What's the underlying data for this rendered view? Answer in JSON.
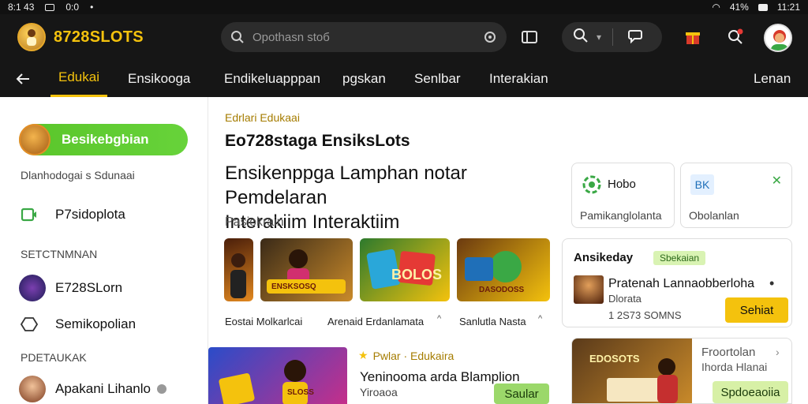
{
  "status": {
    "left_text": "8:1 43",
    "net": "0:0",
    "battery": "41%",
    "time": "11:21"
  },
  "brand": {
    "name": "8728SLOTS"
  },
  "search": {
    "placeholder": "Opothasn stоб"
  },
  "nav": {
    "back_icon": "arrow-left-icon",
    "items": [
      {
        "label": "Edukai",
        "active": true
      },
      {
        "label": "Ensikooga",
        "active": false
      },
      {
        "label": "Endikeluapppan",
        "active": false
      },
      {
        "label": "pgskan",
        "active": false
      },
      {
        "label": "Senlbar",
        "active": false
      },
      {
        "label": "Interakian",
        "active": false
      }
    ],
    "right_label": "Lenan"
  },
  "sidebar": {
    "cta_label": "Besikebgbian",
    "section1_label": "Dlanhodogai s Sdunaai",
    "item_primary": "P7sidoplota",
    "section2_label": "SETCTNMNAN",
    "item_slots": "E728SLorn",
    "item_semi": "Semikopolian",
    "section3_label": "PDETAUKAK",
    "item_profile": "Apakani Lihanlo"
  },
  "main": {
    "crumb": "Edrlari Edukaai",
    "subtitle": "Eo728staga EnsiksLots",
    "headline_line1": "Ensikenppga Lamphan notar Pemdelaran",
    "headline_line2": "Interakiim Interaktiim",
    "muted": "Pasiokrain",
    "thumb2_caption": "ENSKSOSQ",
    "thumb3_caption": "BOLOS",
    "thumb4_caption": "DASODOSS",
    "captions": [
      "Eostai Molkarlcai",
      "Arenaid Erdanlamata",
      "Sanlutla Nasta"
    ],
    "promo_tag": "Pwlar · Edukaira",
    "promo_title": "Yeninooma arda Blamplion",
    "promo_sub": "Yiroaoa",
    "promo_btn": "Saular",
    "promo_thumb_caption": "SLOSS"
  },
  "right": {
    "mini1_title": "Hobo",
    "mini1_sub": "Pamikanglolanta",
    "mini2_badge": "BK",
    "mini2_sub": "Obolanlan",
    "event_title": "Ansikeday",
    "event_tag": "Sbekaian",
    "event_name": "Pratenah Lannaobberloha",
    "event_sub": "Dlorata",
    "event_meta": "1 2S73 SOMNS",
    "event_btn": "Sehiat",
    "event2_line1": "Froortolan",
    "event2_line2": "Ihorda Hlanai",
    "event2_btn": "Spdoeaoiia",
    "event2_thumb_caption": "EDOSOTS"
  },
  "colors": {
    "accent": "#f4c20d",
    "green": "#5ac52a",
    "dark": "#161616"
  }
}
